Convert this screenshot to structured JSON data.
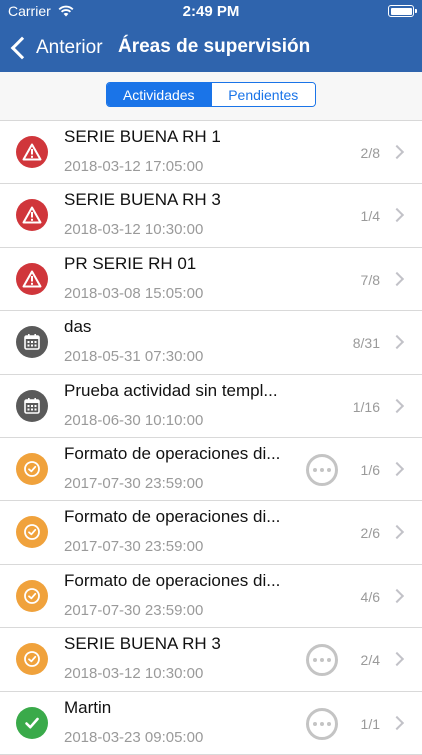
{
  "status_bar": {
    "carrier": "Carrier",
    "time": "2:49 PM"
  },
  "nav": {
    "back_label": "Anterior",
    "title": "Áreas de supervisión"
  },
  "segments": [
    {
      "label": "Actividades",
      "selected": true
    },
    {
      "label": "Pendientes",
      "selected": false
    }
  ],
  "colors": {
    "header": "#2f64ad",
    "accent": "#1a74e8",
    "alert": "#d0363b",
    "calendar": "#5a5a5a",
    "clock": "#f0a23c",
    "done": "#3aaa4a"
  },
  "rows": [
    {
      "title": "SERIE BUENA RH 1",
      "date": "2018-03-12 17:05:00",
      "count": "2/8",
      "icon": "alert-icon",
      "has_more": false
    },
    {
      "title": "SERIE BUENA RH 3",
      "date": "2018-03-12 10:30:00",
      "count": "1/4",
      "icon": "alert-icon",
      "has_more": false
    },
    {
      "title": "PR SERIE RH 01",
      "date": "2018-03-08 15:05:00",
      "count": "7/8",
      "icon": "alert-icon",
      "has_more": false
    },
    {
      "title": "das",
      "date": "2018-05-31 07:30:00",
      "count": "8/31",
      "icon": "calendar-icon",
      "has_more": false
    },
    {
      "title": "Prueba actividad sin templ...",
      "date": "2018-06-30 10:10:00",
      "count": "1/16",
      "icon": "calendar-icon",
      "has_more": false
    },
    {
      "title": "Formato de operaciones di...",
      "date": "2017-07-30 23:59:00",
      "count": "1/6",
      "icon": "clock-icon",
      "has_more": true
    },
    {
      "title": "Formato de operaciones di...",
      "date": "2017-07-30 23:59:00",
      "count": "2/6",
      "icon": "clock-icon",
      "has_more": false
    },
    {
      "title": "Formato de operaciones di...",
      "date": "2017-07-30 23:59:00",
      "count": "4/6",
      "icon": "clock-icon",
      "has_more": false
    },
    {
      "title": "SERIE BUENA RH 3",
      "date": "2018-03-12 10:30:00",
      "count": "2/4",
      "icon": "clock-icon",
      "has_more": true
    },
    {
      "title": "Martin",
      "date": "2018-03-23 09:05:00",
      "count": "1/1",
      "icon": "check-icon",
      "has_more": true
    }
  ]
}
